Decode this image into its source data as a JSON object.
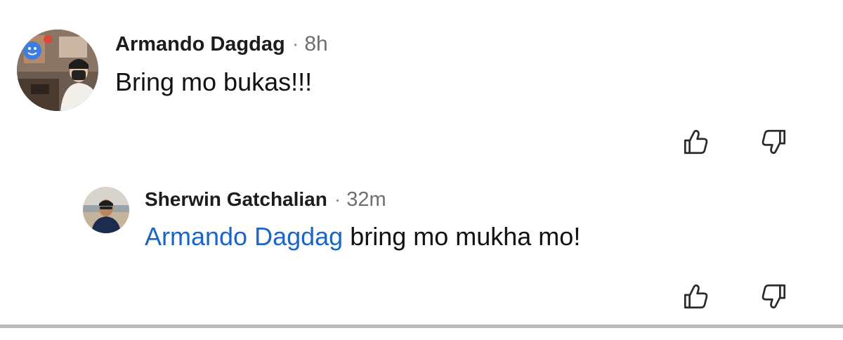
{
  "comments": [
    {
      "author": "Armando Dagdag",
      "separator": "·",
      "time": "8h",
      "text": "Bring mo bukas!!!",
      "avatar_icon": "avatar-photo"
    }
  ],
  "replies": [
    {
      "author": "Sherwin Gatchalian",
      "separator": "·",
      "time": "32m",
      "mention": "Armando Dagdag",
      "text": " bring mo mukha mo!",
      "avatar_icon": "avatar-photo"
    }
  ],
  "icons": {
    "upvote": "thumbs-up-icon",
    "downvote": "thumbs-down-icon"
  },
  "colors": {
    "mention": "#1a66c8",
    "divider": "#b9b9bd"
  }
}
